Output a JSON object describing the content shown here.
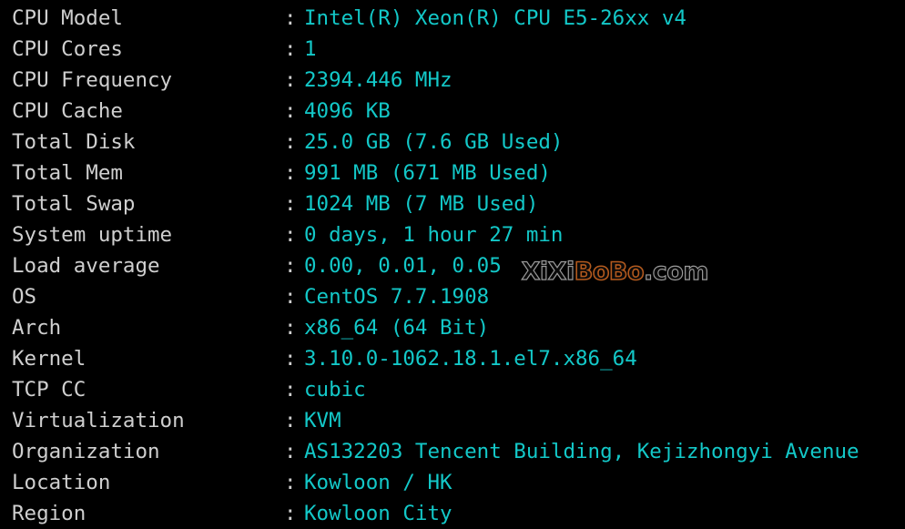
{
  "terminal": {
    "background_color": "#000000",
    "label_color": "#cfcfcf",
    "value_color": "#13c8c8",
    "separator": ":"
  },
  "rows": [
    {
      "label": "CPU Model",
      "value": "Intel(R) Xeon(R) CPU E5-26xx v4"
    },
    {
      "label": "CPU Cores",
      "value": "1"
    },
    {
      "label": "CPU Frequency",
      "value": "2394.446 MHz"
    },
    {
      "label": "CPU Cache",
      "value": "4096 KB"
    },
    {
      "label": "Total Disk",
      "value": "25.0 GB (7.6 GB Used)"
    },
    {
      "label": "Total Mem",
      "value": "991 MB (671 MB Used)"
    },
    {
      "label": "Total Swap",
      "value": "1024 MB (7 MB Used)"
    },
    {
      "label": "System uptime",
      "value": "0 days, 1 hour 27 min"
    },
    {
      "label": "Load average",
      "value": "0.00, 0.01, 0.05"
    },
    {
      "label": "OS",
      "value": "CentOS 7.7.1908"
    },
    {
      "label": "Arch",
      "value": "x86_64 (64 Bit)"
    },
    {
      "label": "Kernel",
      "value": "3.10.0-1062.18.1.el7.x86_64"
    },
    {
      "label": "TCP CC",
      "value": "cubic"
    },
    {
      "label": "Virtualization",
      "value": "KVM"
    },
    {
      "label": "Organization",
      "value": "AS132203 Tencent Building, Kejizhongyi Avenue"
    },
    {
      "label": "Location",
      "value": "Kowloon / HK"
    },
    {
      "label": "Region",
      "value": "Kowloon City"
    }
  ],
  "watermark": {
    "part1": "XiXi",
    "part2": "BoBo",
    "part3": ".com",
    "part1_color": "#9a9a9a",
    "part2_color": "#b35a1e",
    "part3_color": "#9a9a9a"
  }
}
